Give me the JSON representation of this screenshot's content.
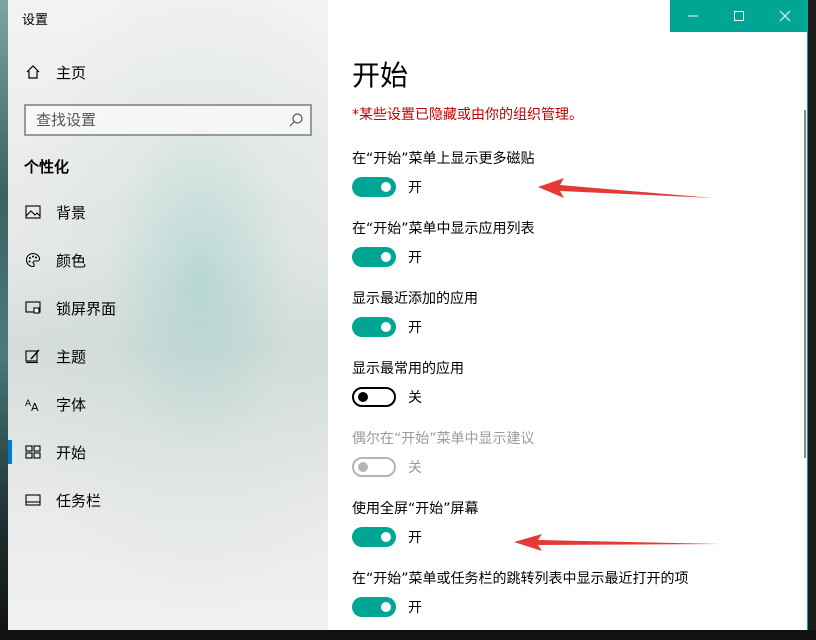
{
  "window": {
    "title": "设置",
    "controls": {
      "minimize": "—",
      "maximize": "☐",
      "close": "✕"
    },
    "accent": "#00a693"
  },
  "sidebar": {
    "home_label": "主页",
    "search_placeholder": "查找设置",
    "section_title": "个性化",
    "items": [
      {
        "label": "背景",
        "icon": "picture-icon"
      },
      {
        "label": "颜色",
        "icon": "palette-icon"
      },
      {
        "label": "锁屏界面",
        "icon": "lock-screen-icon"
      },
      {
        "label": "主题",
        "icon": "theme-brush-icon"
      },
      {
        "label": "字体",
        "icon": "font-icon"
      },
      {
        "label": "开始",
        "icon": "start-icon",
        "active": true
      },
      {
        "label": "任务栏",
        "icon": "taskbar-icon"
      }
    ]
  },
  "main": {
    "title": "开始",
    "notice": "*某些设置已隐藏或由你的组织管理。",
    "notice_color": "#c00000",
    "settings": [
      {
        "label": "在“开始”菜单上显示更多磁贴",
        "state": "开",
        "on": true,
        "disabled": false
      },
      {
        "label": "在“开始”菜单中显示应用列表",
        "state": "开",
        "on": true,
        "disabled": false
      },
      {
        "label": "显示最近添加的应用",
        "state": "开",
        "on": true,
        "disabled": false
      },
      {
        "label": "显示最常用的应用",
        "state": "关",
        "on": false,
        "disabled": false
      },
      {
        "label": "偶尔在“开始”菜单中显示建议",
        "state": "关",
        "on": false,
        "disabled": true
      },
      {
        "label": "使用全屏“开始”屏幕",
        "state": "开",
        "on": true,
        "disabled": false
      },
      {
        "label": "在“开始”菜单或任务栏的跳转列表中显示最近打开的项",
        "state": "开",
        "on": true,
        "disabled": false
      }
    ]
  },
  "annotations": {
    "arrow_color": "#e53935"
  }
}
